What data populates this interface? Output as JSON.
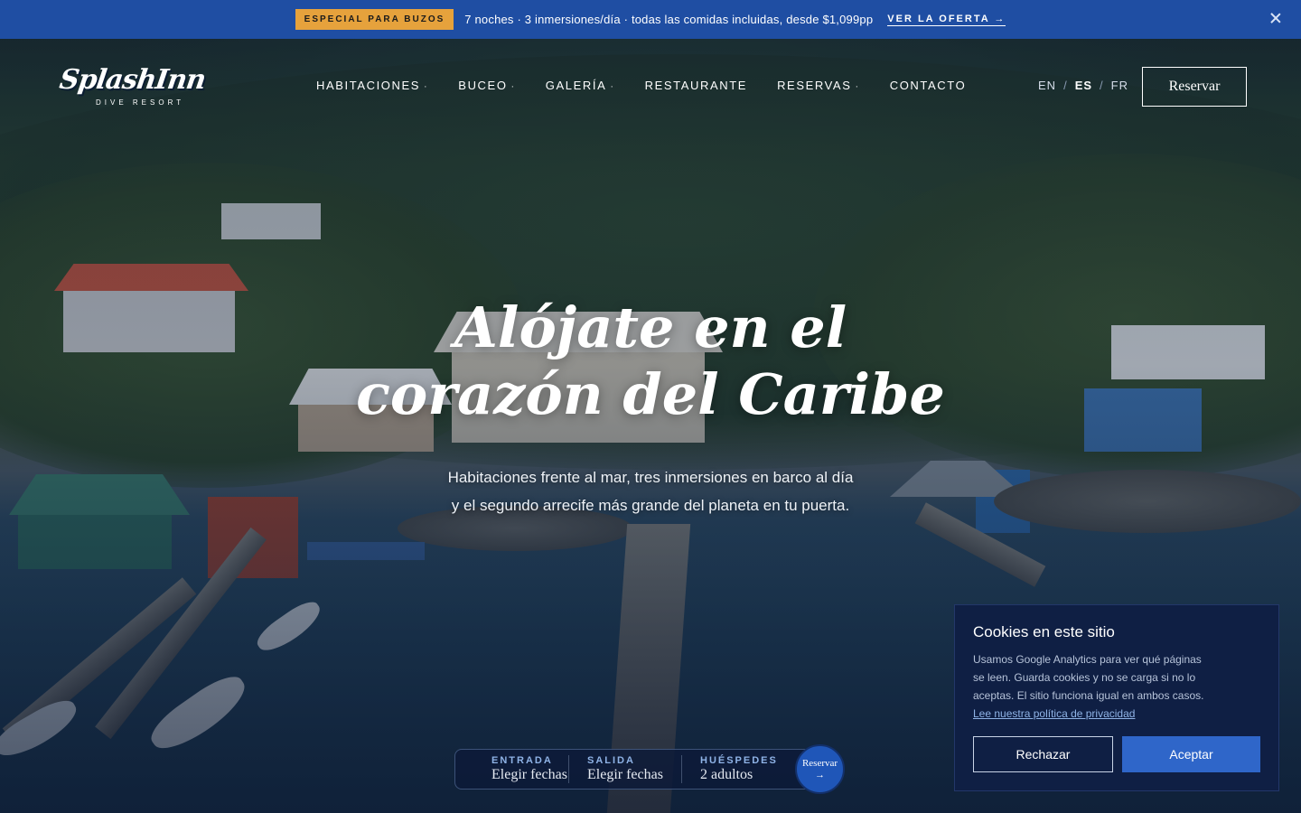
{
  "promo": {
    "badge": "ESPECIAL PARA BUZOS",
    "text": "7 noches · 3 inmersiones/día · todas las comidas incluidas, desde $1,099pp",
    "link_label": "VER LA OFERTA →",
    "close_icon": "close-icon"
  },
  "brand": {
    "name": "SplashInn",
    "tagline": "DIVE RESORT"
  },
  "nav": {
    "items": [
      {
        "label": "HABITACIONES",
        "dropdown": "·"
      },
      {
        "label": "BUCEO",
        "dropdown": "·"
      },
      {
        "label": "GALERÍA",
        "dropdown": "·"
      },
      {
        "label": "RESTAURANTE",
        "dropdown": ""
      },
      {
        "label": "RESERVAS",
        "dropdown": "·"
      },
      {
        "label": "CONTACTO",
        "dropdown": ""
      }
    ]
  },
  "languages": {
    "items": [
      "EN",
      "ES",
      "FR"
    ],
    "active": "ES",
    "separator": "/"
  },
  "header": {
    "reserve_label": "Reservar"
  },
  "hero": {
    "headline_line1": "Alójate en el",
    "headline_line2": "corazón del Caribe",
    "sub_line1": "Habitaciones frente al mar, tres inmersiones en barco al día",
    "sub_line2": "y el segundo arrecife más grande del planeta en tu puerta."
  },
  "booking": {
    "checkin_label": "ENTRADA",
    "checkin_value": "Elegir fechas",
    "checkout_label": "SALIDA",
    "checkout_value": "Elegir fechas",
    "guests_label": "HUÉSPEDES",
    "guests_value": "2 adultos",
    "button_label": "Reservar",
    "button_arrow": "→"
  },
  "cookie": {
    "title": "Cookies en este sitio",
    "body": "Usamos Google Analytics para ver qué páginas se leen. Guarda cookies y no se carga si no lo aceptas. El sitio funciona igual en ambos casos.",
    "link": "Lee nuestra política de privacidad",
    "reject_label": "Rechazar",
    "accept_label": "Aceptar"
  },
  "colors": {
    "promo_bar": "#1f4ea3",
    "promo_badge": "#e6a23c",
    "accent_blue": "#2f66c9",
    "cookie_panel": "#0f1f44"
  }
}
